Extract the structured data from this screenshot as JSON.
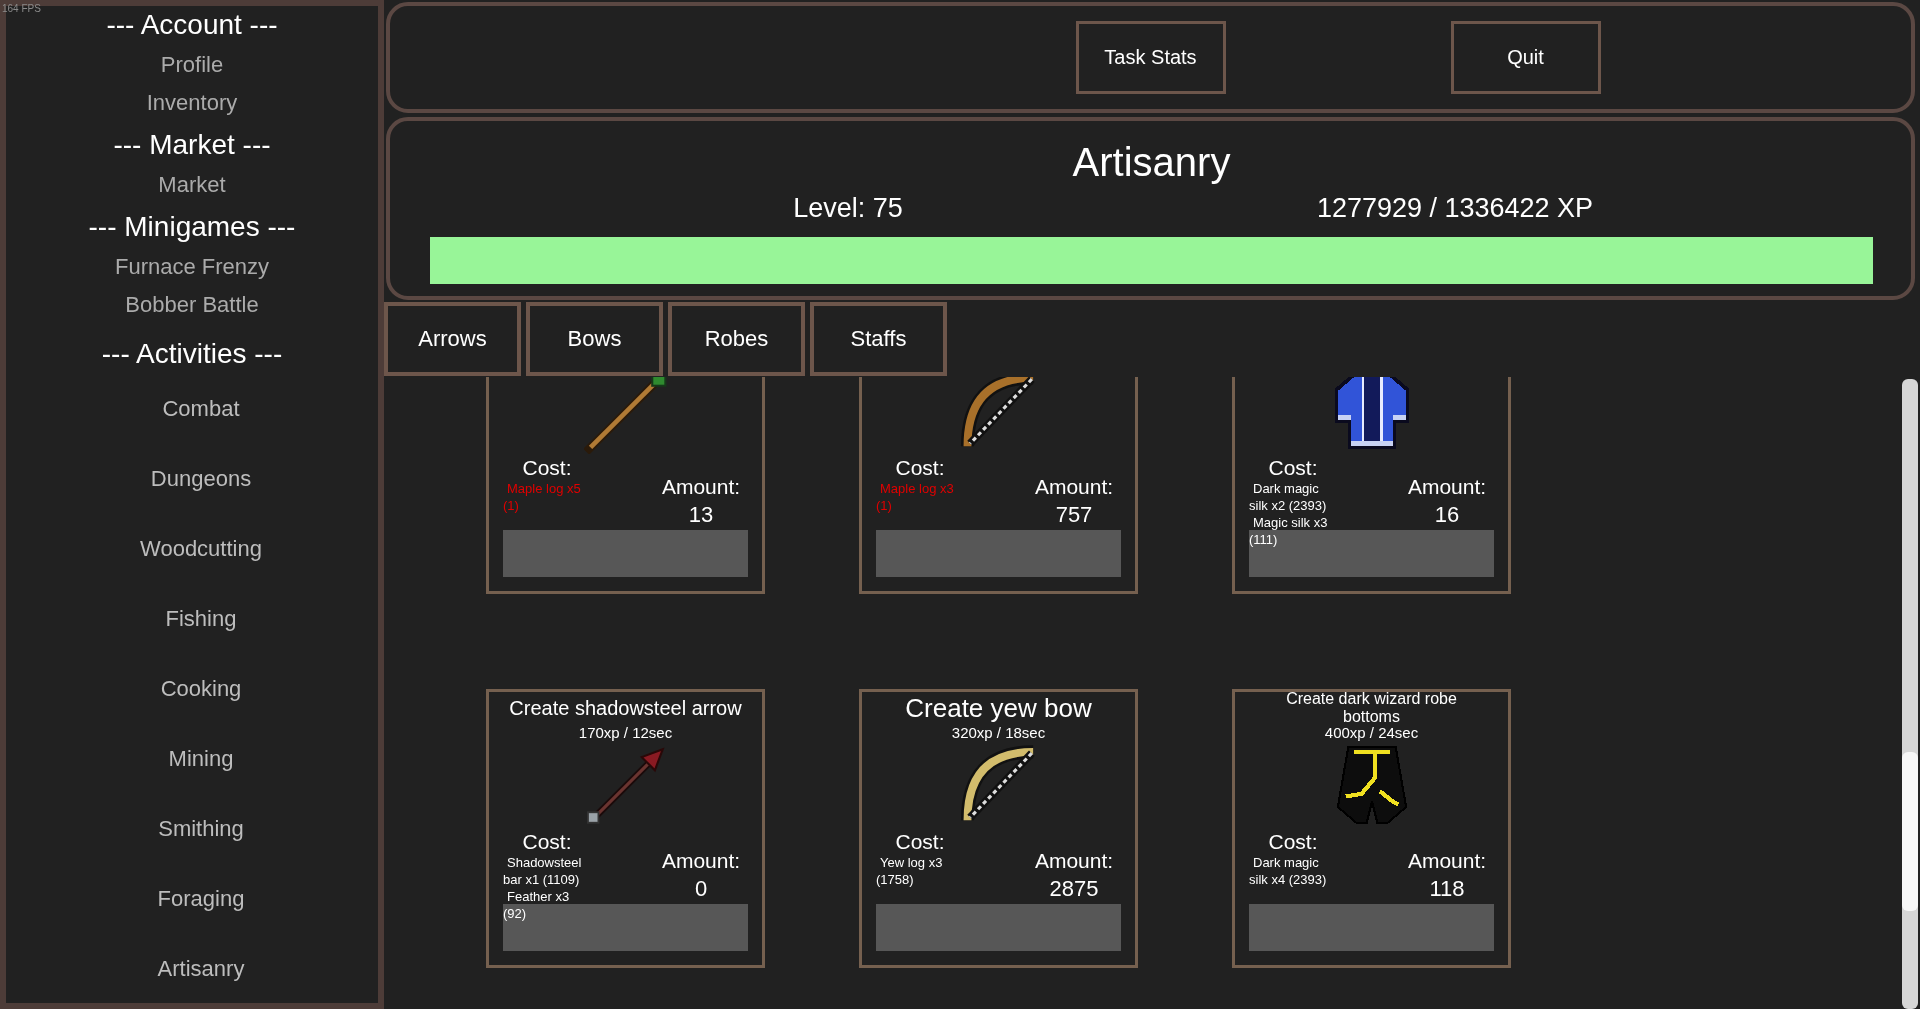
{
  "fps_counter": "164 FPS",
  "sidebar": {
    "sections": [
      {
        "kind": "links",
        "heading": "--- Account ---",
        "items": [
          "Profile",
          "Inventory"
        ]
      },
      {
        "kind": "links",
        "heading": "--- Market ---",
        "items": [
          "Market"
        ]
      },
      {
        "kind": "links",
        "heading": "--- Minigames ---",
        "items": [
          "Furnace Frenzy",
          "Bobber Battle"
        ]
      },
      {
        "kind": "activities",
        "heading": "--- Activities ---",
        "items": [
          "Combat",
          "Dungeons",
          "Woodcutting",
          "Fishing",
          "Cooking",
          "Mining",
          "Smithing",
          "Foraging",
          "Artisanry"
        ]
      }
    ]
  },
  "header": {
    "buttons": [
      "Task Stats",
      "Quit"
    ]
  },
  "skill": {
    "name": "Artisanry",
    "level_text": "Level: 75",
    "xp_text": "1277929 / 1336422 XP",
    "xp_bar": {
      "level": 1
    }
  },
  "tabs": [
    "Arrows",
    "Bows",
    "Robes",
    "Staffs"
  ],
  "recipes": [
    {
      "kind": "staff",
      "cost_label": "Cost:",
      "cost": [
        {
          "text": "Maple log x5 (1)",
          "sufficient": false
        }
      ],
      "amount_label": "Amount:",
      "amount": "13"
    },
    {
      "kind": "maplebow",
      "cost_label": "Cost:",
      "cost": [
        {
          "text": "Maple log x3 (1)",
          "sufficient": false
        }
      ],
      "amount_label": "Amount:",
      "amount": "757"
    },
    {
      "kind": "robetop",
      "cost_label": "Cost:",
      "cost": [
        {
          "text": "Dark magic silk x2 (2393)",
          "sufficient": true
        },
        {
          "text": "Magic silk x3 (111)",
          "sufficient": true
        }
      ],
      "amount_label": "Amount:",
      "amount": "16"
    },
    {
      "kind": "arrow",
      "title": "Create shadowsteel arrow",
      "xp": "170xp / 12sec",
      "cost_label": "Cost:",
      "cost": [
        {
          "text": "Shadowsteel bar x1 (1109)",
          "sufficient": true
        },
        {
          "text": "Feather x3 (92)",
          "sufficient": true
        }
      ],
      "amount_label": "Amount:",
      "amount": "0"
    },
    {
      "kind": "yewbow",
      "title": "Create yew bow",
      "xp": "320xp / 18sec",
      "cost_label": "Cost:",
      "cost": [
        {
          "text": "Yew log x3 (1758)",
          "sufficient": true
        }
      ],
      "amount_label": "Amount:",
      "amount": "2875"
    },
    {
      "kind": "robebottoms",
      "title": "Create dark wizard robe bottoms",
      "xp": "400xp / 24sec",
      "cost_label": "Cost:",
      "cost": [
        {
          "text": "Dark magic silk x4 (2393)",
          "sufficient": true
        }
      ],
      "amount_label": "Amount:",
      "amount": "118"
    }
  ]
}
